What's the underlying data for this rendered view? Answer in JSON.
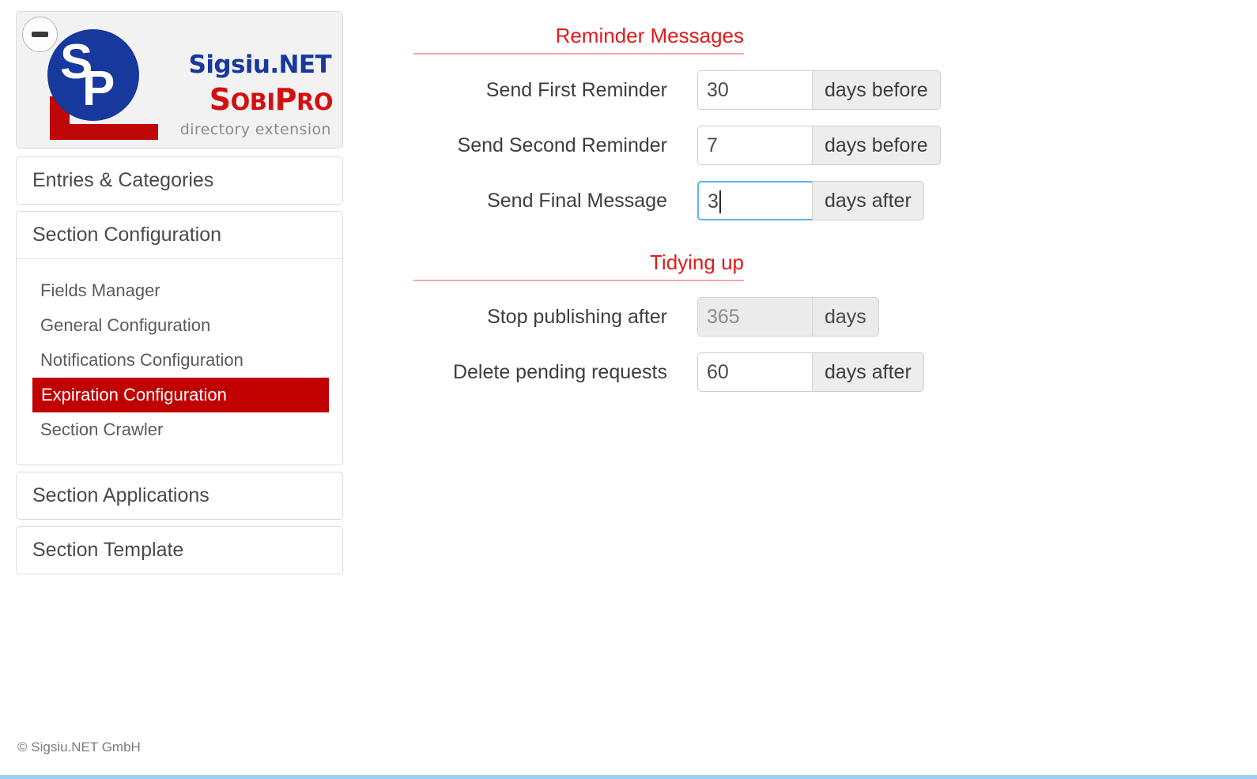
{
  "sidebar": {
    "collapse_button_label": "−",
    "logo": {
      "brand_top": "Sigsiu.NET",
      "brand_main_s": "S",
      "brand_main_obi": "OBI",
      "brand_main_p": "P",
      "brand_main_ro": "RO",
      "brand_tagline": "directory extension",
      "mark_letters": "SP"
    },
    "nav": [
      {
        "label": "Entries & Categories"
      }
    ],
    "section_configuration": {
      "label": "Section Configuration",
      "items": [
        {
          "label": "Fields Manager",
          "active": false
        },
        {
          "label": "General Configuration",
          "active": false
        },
        {
          "label": "Notifications Configuration",
          "active": false
        },
        {
          "label": "Expiration Configuration",
          "active": true
        },
        {
          "label": "Section Crawler",
          "active": false
        }
      ]
    },
    "bottom_nav": [
      {
        "label": "Section Applications"
      },
      {
        "label": "Section Template"
      }
    ],
    "footer": "© Sigsiu.NET GmbH"
  },
  "main": {
    "sections": [
      {
        "title": "Reminder Messages",
        "rows": [
          {
            "label": "Send First Reminder",
            "value": "30",
            "unit": "days before",
            "focused": false,
            "disabled": false
          },
          {
            "label": "Send Second Reminder",
            "value": "7",
            "unit": "days before",
            "focused": false,
            "disabled": false
          },
          {
            "label": "Send Final Message",
            "value": "3",
            "unit": "days after",
            "focused": true,
            "disabled": false
          }
        ]
      },
      {
        "title": "Tidying up",
        "rows": [
          {
            "label": "Stop publishing after",
            "value": "365",
            "unit": "days",
            "focused": false,
            "disabled": true
          },
          {
            "label": "Delete pending requests",
            "value": "60",
            "unit": "days after",
            "focused": false,
            "disabled": false
          }
        ]
      }
    ]
  },
  "colors": {
    "accent_red": "#c10000",
    "header_red": "#e01b1b",
    "header_rule": "#f3a9a9",
    "focus_blue": "#5cb3ec",
    "brand_blue": "#17389c",
    "bottom_rule": "#9ecdef"
  }
}
